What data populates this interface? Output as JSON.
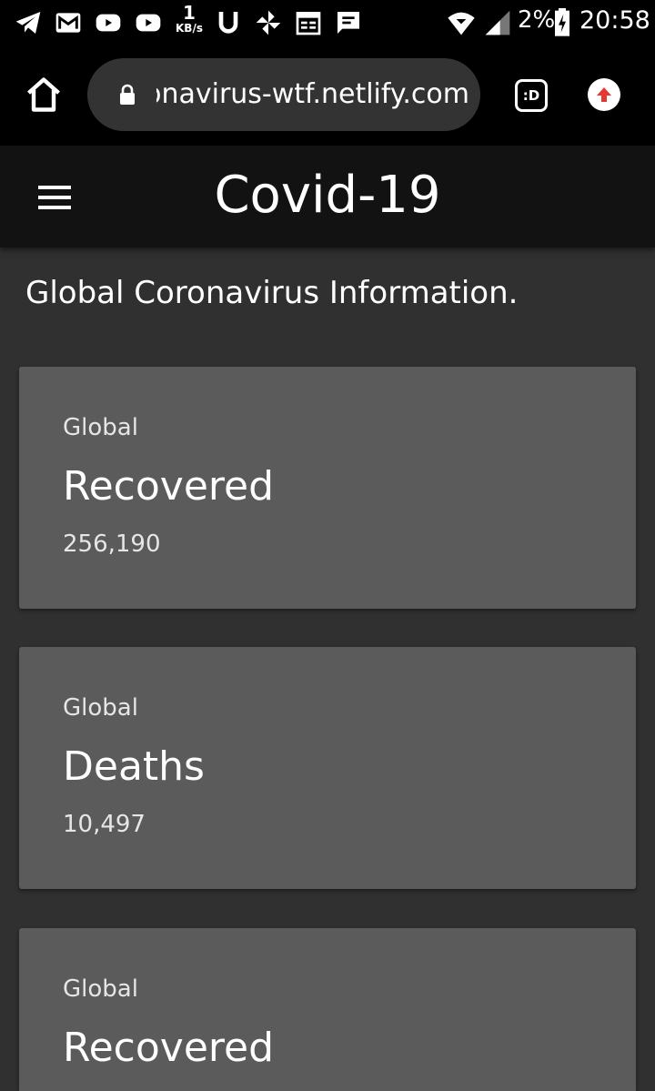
{
  "status_bar": {
    "net_speed_value": "1",
    "net_speed_unit": "KB/s",
    "battery": "2%",
    "time": "20:58"
  },
  "browser": {
    "url": "coronavirus-wtf.netlify.com",
    "extension_label": ":D"
  },
  "app_bar": {
    "title": "Covid-19"
  },
  "page": {
    "heading": "Global Coronavirus Information."
  },
  "cards": [
    {
      "overline": "Global",
      "title": "Recovered",
      "value": "256,190"
    },
    {
      "overline": "Global",
      "title": "Deaths",
      "value": "10,497"
    },
    {
      "overline": "Global",
      "title": "Recovered"
    }
  ],
  "colors": {
    "background": "#303030",
    "app_bar": "#121212",
    "card": "#5b5b5b",
    "upload_arrow": "#e53935"
  },
  "icons": [
    "telegram-icon",
    "gmail-icon",
    "youtube-icon",
    "u-icon",
    "pinwheel-icon",
    "calendar-icon",
    "message-icon",
    "wifi-icon",
    "signal-icon",
    "battery-icon",
    "home-icon",
    "lock-icon",
    "menu-icon",
    "upload-icon"
  ]
}
